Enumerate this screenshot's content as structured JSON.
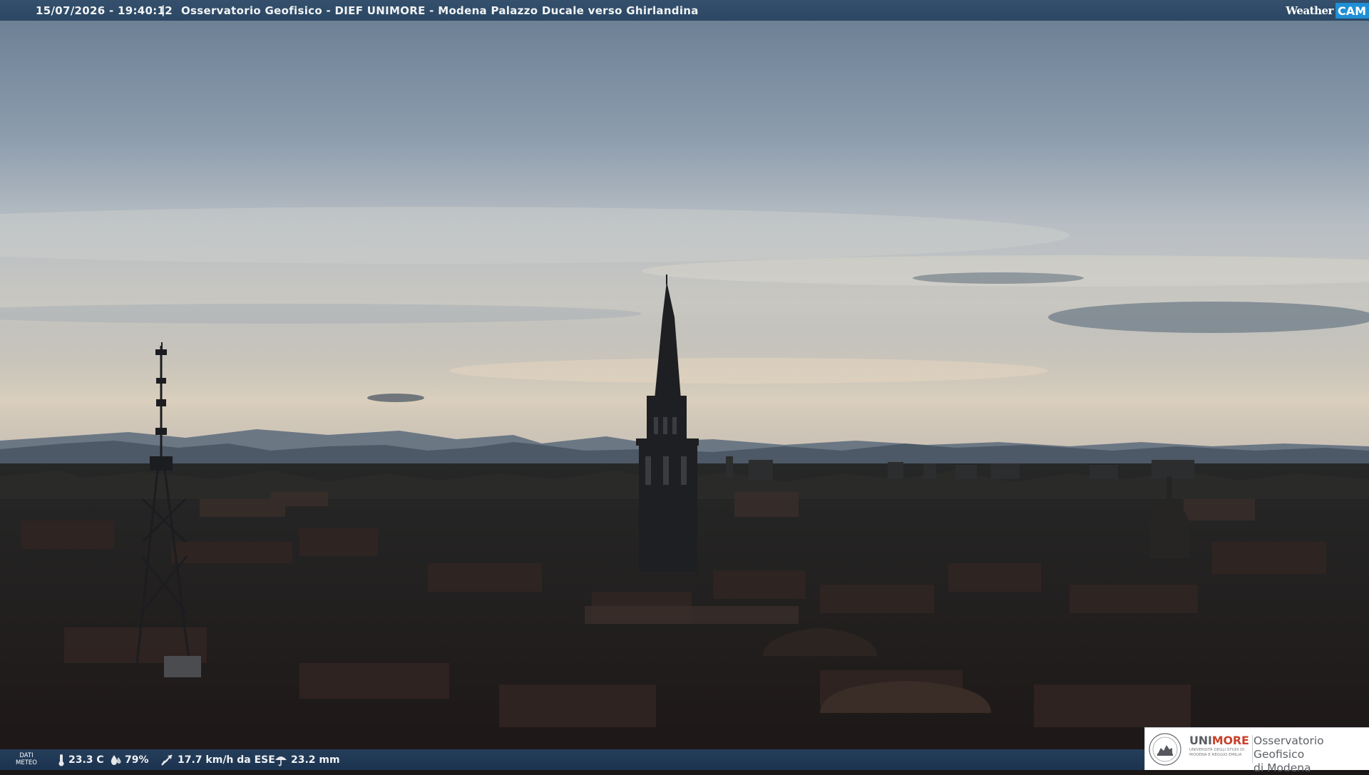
{
  "header": {
    "datetime": "15/07/2026 - 19:40:12",
    "separator": "|",
    "title": "Osservatorio Geofisico - DIEF UNIMORE - Modena Palazzo Ducale verso Ghirlandina"
  },
  "brand": {
    "word": "Weather",
    "cam": "CAM"
  },
  "weather": {
    "dati_line1": "DATI",
    "dati_line2": "METEO",
    "temperature": "23.3 C",
    "humidity": "79%",
    "wind": "17.7 km/h da ESE",
    "rain": "23.2 mm"
  },
  "logo": {
    "uni": "UNI",
    "more": "MORE",
    "subtitle": "UNIVERSITÀ DEGLI STUDI DI MODENA E REGGIO EMILIA",
    "obs_line1": "Osservatorio Geofisico",
    "obs_line2": "di Modena"
  },
  "colors": {
    "bar": "#2b4763",
    "brand_blue": "#1f8fd6",
    "unimore_red": "#c7422c"
  }
}
